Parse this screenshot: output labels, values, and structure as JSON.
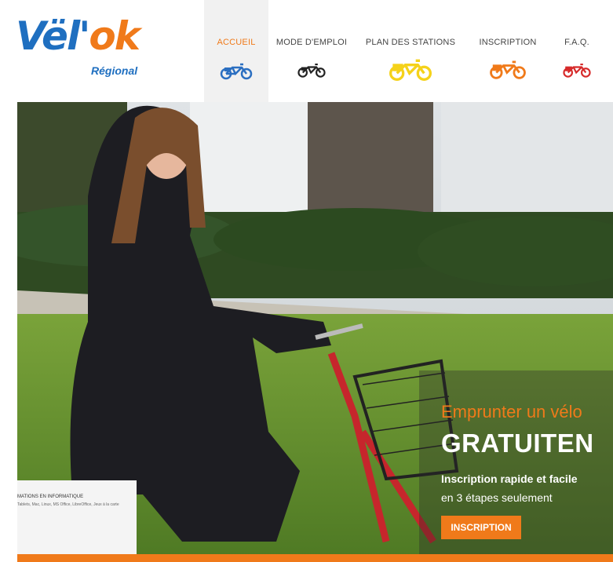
{
  "logo": {
    "vel": "Vël'",
    "ok": "ok",
    "subtitle": "Régional"
  },
  "nav": {
    "items": [
      {
        "label": "ACCUEIL",
        "active": true,
        "bike_color": "#2b6fc1"
      },
      {
        "label": "MODE D'EMPLOI",
        "active": false,
        "bike_color": "#222222"
      },
      {
        "label": "PLAN DES STATIONS",
        "active": false,
        "bike_color": "#f5d21a"
      },
      {
        "label": "INSCRIPTION",
        "active": false,
        "bike_color": "#f07a1a"
      },
      {
        "label": "F.A.Q.",
        "active": false,
        "bike_color": "#d62a2a"
      }
    ]
  },
  "hero": {
    "promo_line1": "Emprunter un vélo",
    "promo_line2": "GRATUITEN",
    "promo_line3": "Inscription rapide et facile",
    "promo_line4": "en 3 étapes seulement",
    "cta_label": "INSCRIPTION",
    "sign_text": "MATIONS EN INFORMATIQUE",
    "sign_sub": "Tablets, Mac, Linux, MS Office, LibreOffice, Jeux à la carte"
  },
  "colors": {
    "accent": "#f07a1a",
    "brand_blue": "#1f6fc0"
  }
}
